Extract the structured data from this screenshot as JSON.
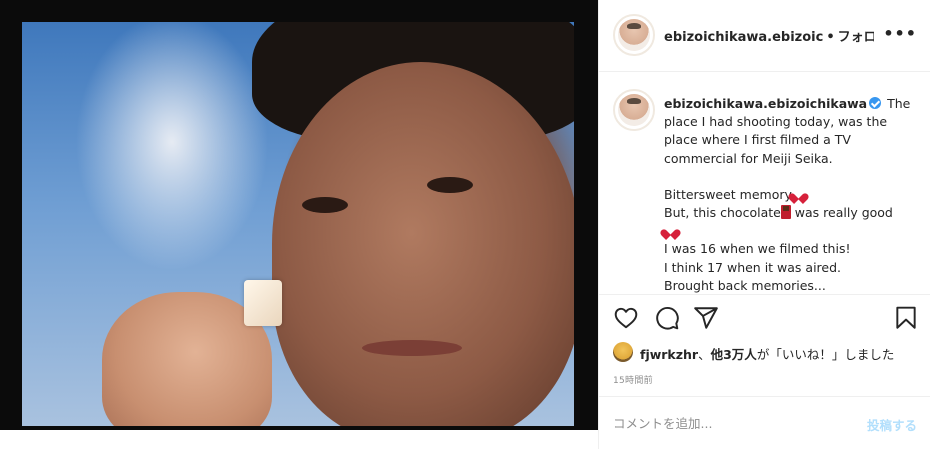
{
  "header": {
    "username": "ebizoichikawa.ebizoic",
    "separator": "•",
    "follow_status": "フォロー中",
    "more_icon": "more-horizontal-icon"
  },
  "caption": {
    "username": "ebizoichikawa.ebizoichikawa",
    "lines": {
      "l1": "The place I had shooting today, was the place where I first filmed a TV commercial for Meiji Seika.",
      "l2": "Bittersweet memory",
      "l3a": "But, this chocolate",
      "l3b": " was really good",
      "l4": "I was 16 when we filmed this!",
      "l5": "I think 17 when it was aired.",
      "l6": "Brought back memories..."
    }
  },
  "actions": {
    "like_icon": "heart-icon",
    "comment_icon": "comment-icon",
    "share_icon": "share-icon",
    "save_icon": "bookmark-icon"
  },
  "likes": {
    "first_user": "fjwrkzhr",
    "middle": "、",
    "others": "他3万人",
    "suffix": "が「いいね！」しました"
  },
  "timestamp": "15時間前",
  "comment": {
    "placeholder": "コメントを追加...",
    "post_label": "投稿する"
  },
  "colors": {
    "verified": "#3897f0",
    "post_button_disabled": "#b2dffc",
    "muted_text": "#8e8e8e",
    "text": "#262626"
  }
}
